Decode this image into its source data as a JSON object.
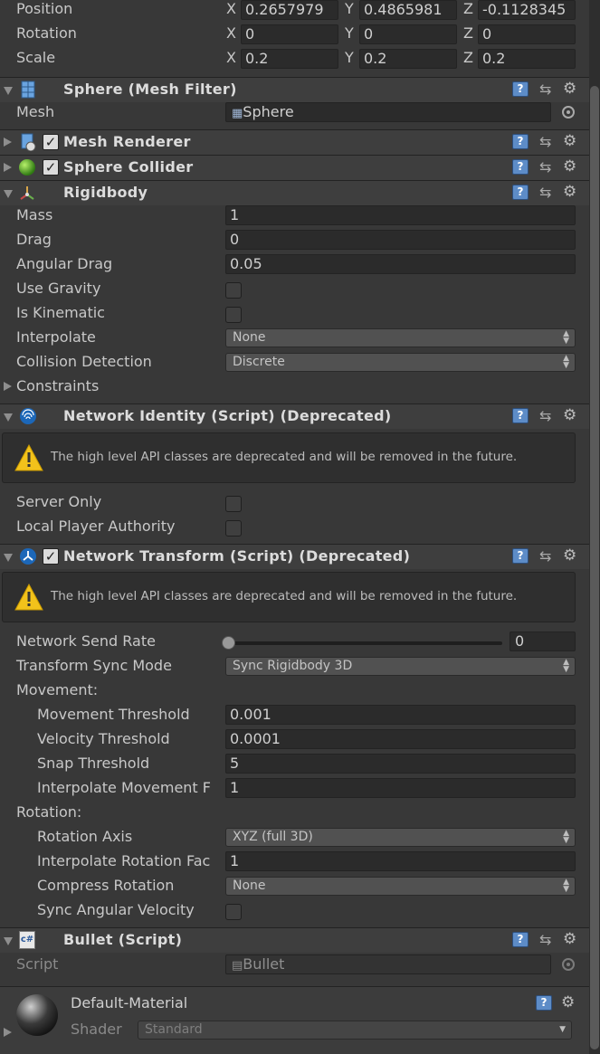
{
  "transform": {
    "position": {
      "label": "Position",
      "x": "0.2657979",
      "y": "0.4865981",
      "z": "-0.1128345"
    },
    "rotation": {
      "label": "Rotation",
      "x": "0",
      "y": "0",
      "z": "0"
    },
    "scale": {
      "label": "Scale",
      "x": "0.2",
      "y": "0.2",
      "z": "0.2"
    },
    "axis_labels": {
      "x": "X",
      "y": "Y",
      "z": "Z"
    }
  },
  "mesh_filter": {
    "title": "Sphere (Mesh Filter)",
    "mesh_label": "Mesh",
    "mesh_value": "Sphere"
  },
  "mesh_renderer": {
    "title": "Mesh Renderer"
  },
  "sphere_collider": {
    "title": "Sphere Collider"
  },
  "rigidbody": {
    "title": "Rigidbody",
    "mass_label": "Mass",
    "mass": "1",
    "drag_label": "Drag",
    "drag": "0",
    "angular_drag_label": "Angular Drag",
    "angular_drag": "0.05",
    "use_gravity_label": "Use Gravity",
    "is_kinematic_label": "Is Kinematic",
    "interpolate_label": "Interpolate",
    "interpolate": "None",
    "collision_label": "Collision Detection",
    "collision": "Discrete",
    "constraints_label": "Constraints"
  },
  "network_identity": {
    "title": "Network Identity (Script) (Deprecated)",
    "warning": "The high level API classes are deprecated and will be removed in the future.",
    "server_only_label": "Server Only",
    "local_authority_label": "Local Player Authority"
  },
  "network_transform": {
    "title": "Network Transform (Script) (Deprecated)",
    "warning": "The high level API classes are deprecated and will be removed in the future.",
    "send_rate_label": "Network Send Rate",
    "send_rate": "0",
    "sync_mode_label": "Transform Sync Mode",
    "sync_mode": "Sync Rigidbody 3D",
    "movement_label": "Movement:",
    "movement_threshold_label": "Movement Threshold",
    "movement_threshold": "0.001",
    "velocity_threshold_label": "Velocity Threshold",
    "velocity_threshold": "0.0001",
    "snap_threshold_label": "Snap Threshold",
    "snap_threshold": "5",
    "interp_movement_label": "Interpolate Movement F",
    "interp_movement": "1",
    "rotation_label": "Rotation:",
    "rotation_axis_label": "Rotation Axis",
    "rotation_axis": "XYZ (full 3D)",
    "interp_rotation_label": "Interpolate Rotation Fac",
    "interp_rotation": "1",
    "compress_rotation_label": "Compress Rotation",
    "compress_rotation": "None",
    "sync_angular_label": "Sync Angular Velocity"
  },
  "bullet": {
    "title": "Bullet (Script)",
    "script_label": "Script",
    "script_value": "Bullet",
    "cs_badge": "c#"
  },
  "material": {
    "name": "Default-Material",
    "shader_label": "Shader",
    "shader_value": "Standard"
  },
  "icons": {
    "help": "?",
    "gear": "⚙",
    "preset": "⇆",
    "check": "✓",
    "dropdown_arrow": "▲▼"
  }
}
